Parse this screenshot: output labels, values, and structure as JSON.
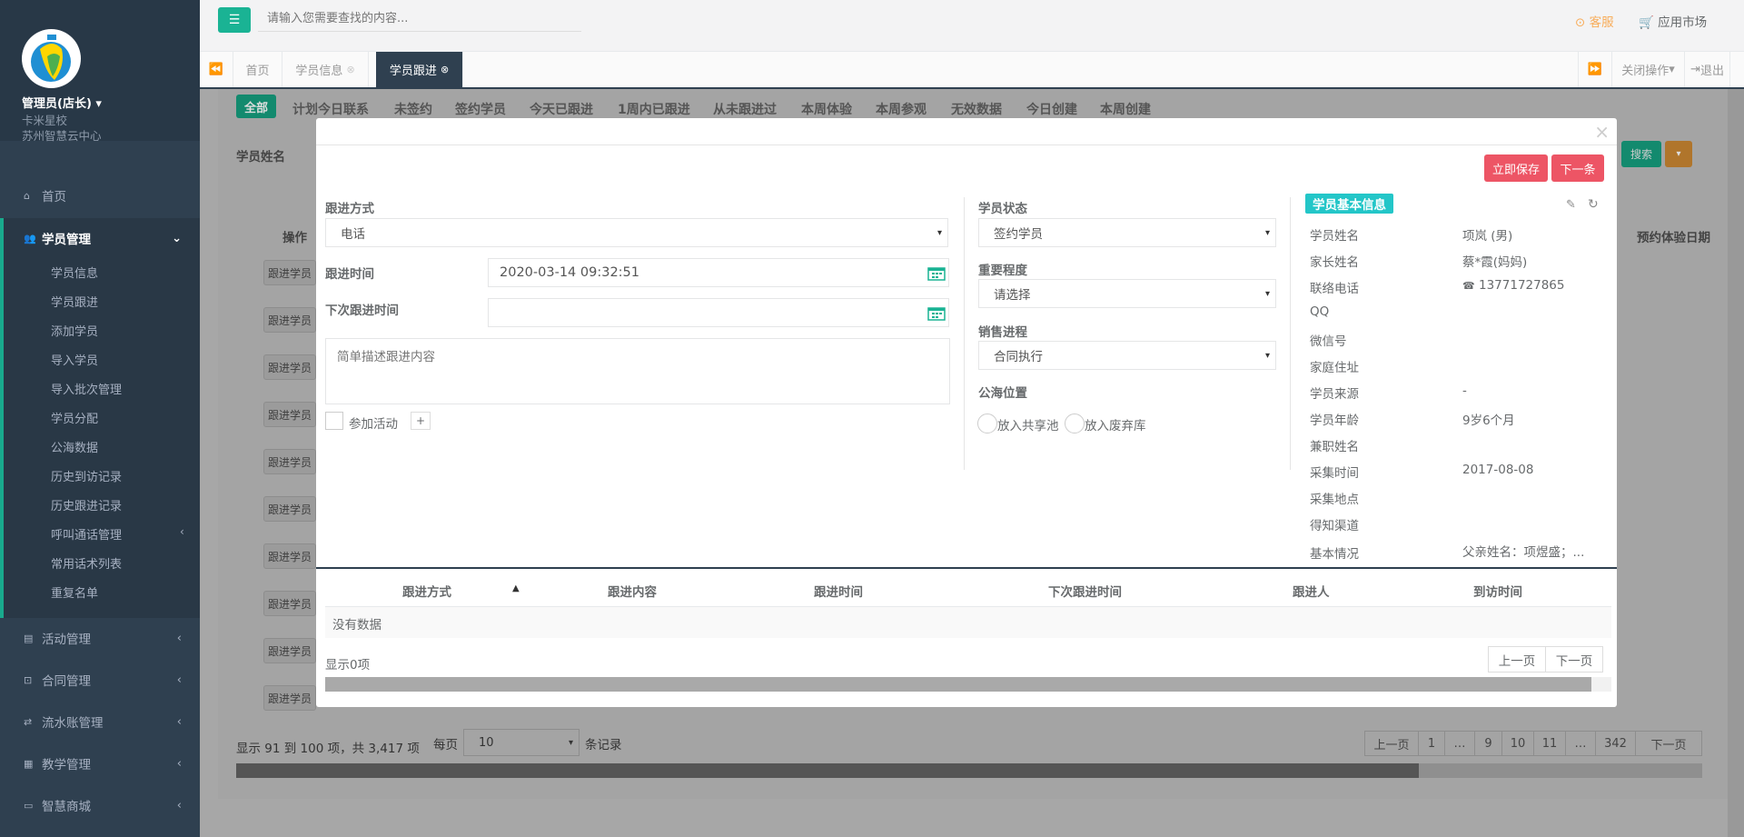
{
  "sidebar": {
    "user": "管理员(店长)",
    "sub1": "卡米星校",
    "sub2": "苏州智慧云中心",
    "nav": [
      {
        "label": "首页",
        "icon": "home-icon"
      },
      {
        "label": "学员管理",
        "icon": "users-icon"
      },
      {
        "label": "活动管理",
        "icon": "map-icon"
      },
      {
        "label": "合同管理",
        "icon": "cart-icon"
      },
      {
        "label": "流水账管理",
        "icon": "retweet-icon"
      },
      {
        "label": "教学管理",
        "icon": "calendar-icon"
      },
      {
        "label": "智慧商城",
        "icon": "hdd-icon"
      }
    ],
    "submenu": [
      "学员信息",
      "学员跟进",
      "添加学员",
      "导入学员",
      "导入批次管理",
      "学员分配",
      "公海数据",
      "历史到访记录",
      "历史跟进记录",
      "呼叫通话管理",
      "常用话术列表",
      "重复名单"
    ]
  },
  "topbar": {
    "search_placeholder": "请输入您需要查找的内容...",
    "service": "客服",
    "market": "应用市场"
  },
  "tabs": {
    "home": "首页",
    "info": "学员信息",
    "follow": "学员跟进",
    "close_ops": "关闭操作",
    "logout": "退出"
  },
  "background": {
    "filters": [
      "全部",
      "计划今日联系",
      "未签约",
      "签约学员",
      "今天已跟进",
      "1周内已跟进",
      "从未跟进过",
      "本周体验",
      "本周参观",
      "无效数据",
      "今日创建",
      "本周创建"
    ],
    "name_label": "学员姓名",
    "op_col": "操作",
    "appt_col": "预约体验日期",
    "row_btn": "跟进学员",
    "search_btn": "搜索",
    "summary": "显示 91 到 100 项，共 3,417 项",
    "per_page": "每页",
    "page_size": "10",
    "records": "条记录",
    "pages": [
      "上一页",
      "1",
      "…",
      "9",
      "10",
      "11",
      "…",
      "342",
      "下一页"
    ]
  },
  "modal": {
    "save": "立即保存",
    "next": "下一条",
    "method_label": "跟进方式",
    "method_value": "电话",
    "time_label": "跟进时间",
    "time_value": "2020-03-14 09:32:51",
    "next_time_label": "下次跟进时间",
    "next_time_value": "",
    "desc_placeholder": "简单描述跟进内容",
    "activity_label": "参加活动",
    "plus": "+",
    "status_label": "学员状态",
    "status_value": "签约学员",
    "importance_label": "重要程度",
    "importance_value": "请选择",
    "sales_label": "销售进程",
    "sales_value": "合同执行",
    "sea_label": "公海位置",
    "share_pool": "放入共享池",
    "discard_pool": "放入废弃库",
    "info_title": "学员基本信息",
    "info": [
      {
        "k": "学员姓名",
        "v": "项岚 (男)"
      },
      {
        "k": "家长姓名",
        "v": "蔡*霞(妈妈)"
      },
      {
        "k": "联络电话",
        "v": "13771727865"
      },
      {
        "k": "QQ",
        "v": ""
      },
      {
        "k": "微信号",
        "v": ""
      },
      {
        "k": "家庭住址",
        "v": ""
      },
      {
        "k": "学员来源",
        "v": "-"
      },
      {
        "k": "学员年龄",
        "v": "9岁6个月"
      },
      {
        "k": "兼职姓名",
        "v": ""
      },
      {
        "k": "采集时间",
        "v": "2017-08-08"
      },
      {
        "k": "采集地点",
        "v": ""
      },
      {
        "k": "得知渠道",
        "v": ""
      },
      {
        "k": "基本情况",
        "v": "父亲姓名：项煜盛；..."
      }
    ],
    "table_headers": [
      "跟进方式",
      "跟进内容",
      "跟进时间",
      "下次跟进时间",
      "跟进人",
      "到访时间"
    ],
    "no_data": "没有数据",
    "show_count": "显示0项",
    "prev": "上一页",
    "next_page": "下一页"
  },
  "colors": {
    "accent": "#1ab394",
    "danger": "#ed5565",
    "sidebar": "#2f4050",
    "info": "#23c6c8"
  }
}
